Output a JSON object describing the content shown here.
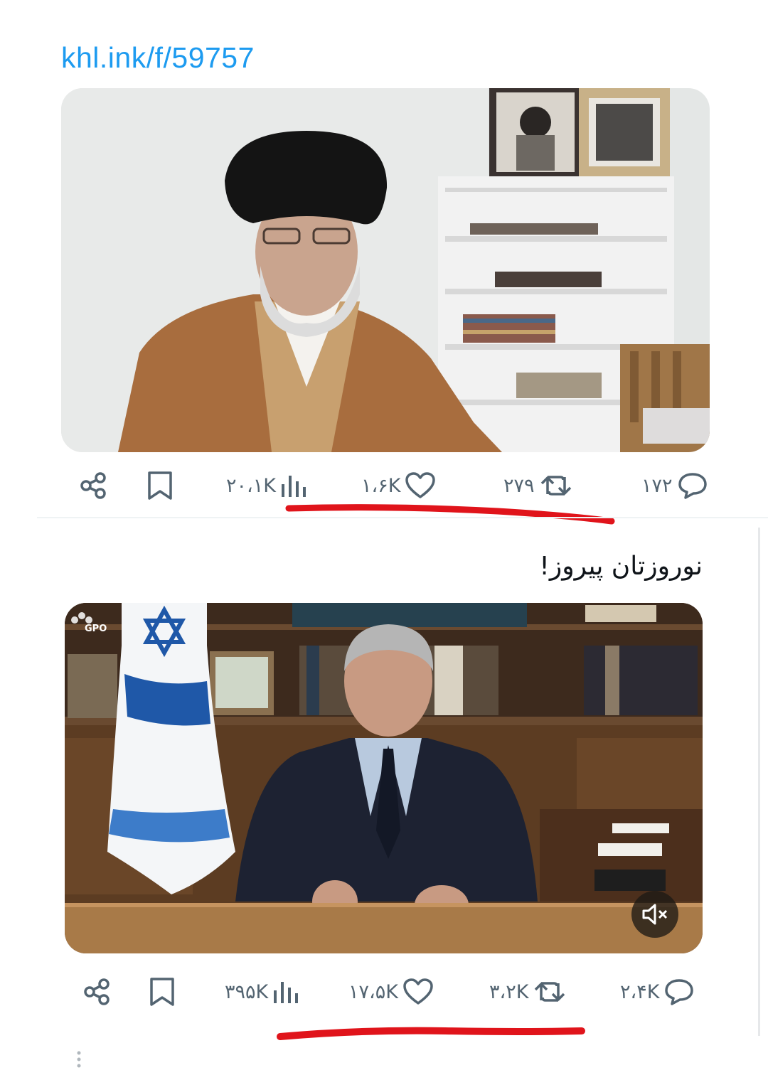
{
  "link": {
    "text": "khl.ink/f/59757"
  },
  "tweet1": {
    "image_alt": "photo",
    "stats": {
      "views": "۲۰،۱K",
      "likes": "۱،۶K",
      "retweets": "۲۷۹",
      "replies": "۱۷۲"
    }
  },
  "tweet2": {
    "text": "نوروزتان پیروز!",
    "image_watermark": "GPO",
    "stats": {
      "views": "۳۹۵K",
      "likes": "۱۷،۵K",
      "retweets": "۳،۲K",
      "replies": "۲،۴K"
    }
  },
  "icons": {
    "share": "share-icon",
    "bookmark": "bookmark-icon",
    "views": "views-chart-icon",
    "like": "heart-icon",
    "retweet": "retweet-icon",
    "reply": "reply-bubble-icon",
    "mute": "muted-speaker-icon"
  },
  "colors": {
    "link": "#1d9bf0",
    "icon": "#536471",
    "annotation": "#e0141b"
  }
}
